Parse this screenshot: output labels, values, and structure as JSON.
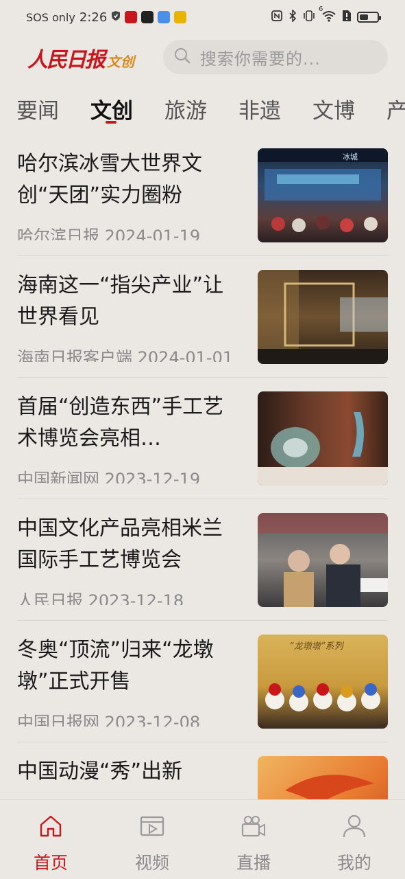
{
  "status_bar": {
    "carrier": "SOS only",
    "time": "2:26",
    "network": "6",
    "battery_level": 0.5
  },
  "header": {
    "logo_main": "人民日报",
    "logo_sub": "文创",
    "search_placeholder": "搜索你需要的..."
  },
  "tabs": [
    "要闻",
    "文创",
    "旅游",
    "非遗",
    "文博",
    "产"
  ],
  "active_tab": "文创",
  "articles": [
    {
      "title": "哈尔滨冰雪大世界文创“天团”实力圈粉",
      "source": "哈尔滨日报",
      "date": "2024-01-19",
      "thumb_text": "冰城"
    },
    {
      "title": "海南这一“指尖产业”让世界看见",
      "source": "海南日报客户端",
      "date": "2024-01-01",
      "thumb_text": ""
    },
    {
      "title": "首届“创造东西”手工艺术博览会亮相…",
      "source": "中国新闻网",
      "date": "2023-12-19",
      "thumb_text": ""
    },
    {
      "title": "中国文化产品亮相米兰国际手工艺博览会",
      "source": "人民日报",
      "date": "2023-12-18",
      "thumb_text": ""
    },
    {
      "title": "冬奥“顶流”归来“龙墩墩”正式开售",
      "source": "中国日报网",
      "date": "2023-12-08",
      "thumb_text": "“龙墩墩”系列"
    },
    {
      "title": "中国动漫“秀”出新",
      "source": "",
      "date": "",
      "thumb_text": ""
    }
  ],
  "bottom_nav": [
    {
      "label": "首页",
      "icon": "home-icon",
      "active": true
    },
    {
      "label": "视频",
      "icon": "video-icon",
      "active": false
    },
    {
      "label": "直播",
      "icon": "live-camera-icon",
      "active": false
    },
    {
      "label": "我的",
      "icon": "user-icon",
      "active": false
    }
  ],
  "colors": {
    "background": "#ebe8e4",
    "accent_red": "#c8161d",
    "logo_orange": "#d98a1f",
    "inactive_gray": "#8a8a8a"
  }
}
